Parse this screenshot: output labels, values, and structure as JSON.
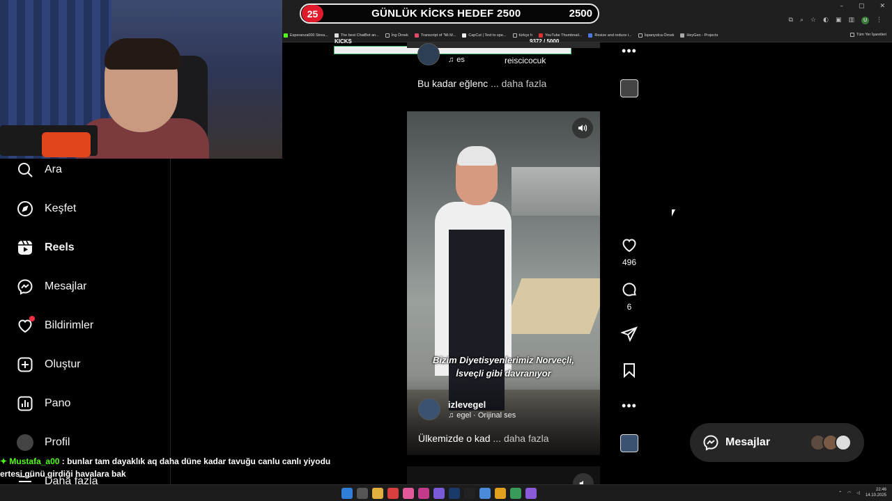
{
  "browser": {
    "window_controls": [
      "–",
      "▢",
      "✕"
    ],
    "bookmarks": [
      "Esperanza000 Strea...",
      "The best ChatBot an...",
      "İng Örnek",
      "Transcript of \"Mi M...",
      "CapCut | Text to spe...",
      "türkçe h",
      "YouTube Thumbnail...",
      "Resize and reduce i...",
      "İspanyolca Örnek",
      "HeyGen - Projects"
    ],
    "bookmarks_all": "Tüm Yer İşaretleri",
    "profile_initial": "U"
  },
  "stream_overlay": {
    "goal_count": "25",
    "goal_title": "GÜNLÜK KİCKS HEDEF 2500",
    "goal_target": "2500",
    "kicks_label": "KICKS",
    "kicks_value": "9372   / 5000",
    "kicks_progress": 1.0,
    "chat": {
      "username": "Mustafa_a00",
      "message_line1": " : bunlar tam dayaklık aq daha düne kadar tavuğu canlu canlı yiyodu",
      "message_line2": "ertesi günü girdiği havalara bak"
    }
  },
  "sidebar": {
    "items": [
      {
        "label": "Ara",
        "icon": "search-icon"
      },
      {
        "label": "Keşfet",
        "icon": "compass-icon"
      },
      {
        "label": "Reels",
        "icon": "reels-icon",
        "active": true
      },
      {
        "label": "Mesajlar",
        "icon": "messenger-icon"
      },
      {
        "label": "Bildirimler",
        "icon": "heart-icon"
      },
      {
        "label": "Oluştur",
        "icon": "plus-square-icon"
      },
      {
        "label": "Pano",
        "icon": "chart-icon"
      },
      {
        "label": "Profil",
        "icon": "avatar"
      },
      {
        "label": "Daha fazla",
        "icon": "menu-icon"
      }
    ]
  },
  "previous_post": {
    "username": "reiscicocuk",
    "audio": "es",
    "audio_user": "reiscicocuk",
    "description": "Bu kadar eğlenc",
    "more": "... daha fazla"
  },
  "current_post": {
    "caption_line1": "Bizim Diyetisyenlerimiz Norveçli,",
    "caption_line2": "İsveçli gibi davranıyor",
    "username": "izlevegel",
    "audio": "egel · Orijinal ses",
    "description": "Ülkemizde o kad",
    "more": "... daha fazla",
    "likes": "496",
    "comments": "6"
  },
  "messages_pill": {
    "label": "Mesajlar"
  },
  "taskbar": {
    "time": "22:46",
    "date": "14.10.2025"
  },
  "colors": {
    "accent_red": "#e01b2b",
    "kick_green": "#53fc18",
    "notification_red": "#ff3040"
  }
}
